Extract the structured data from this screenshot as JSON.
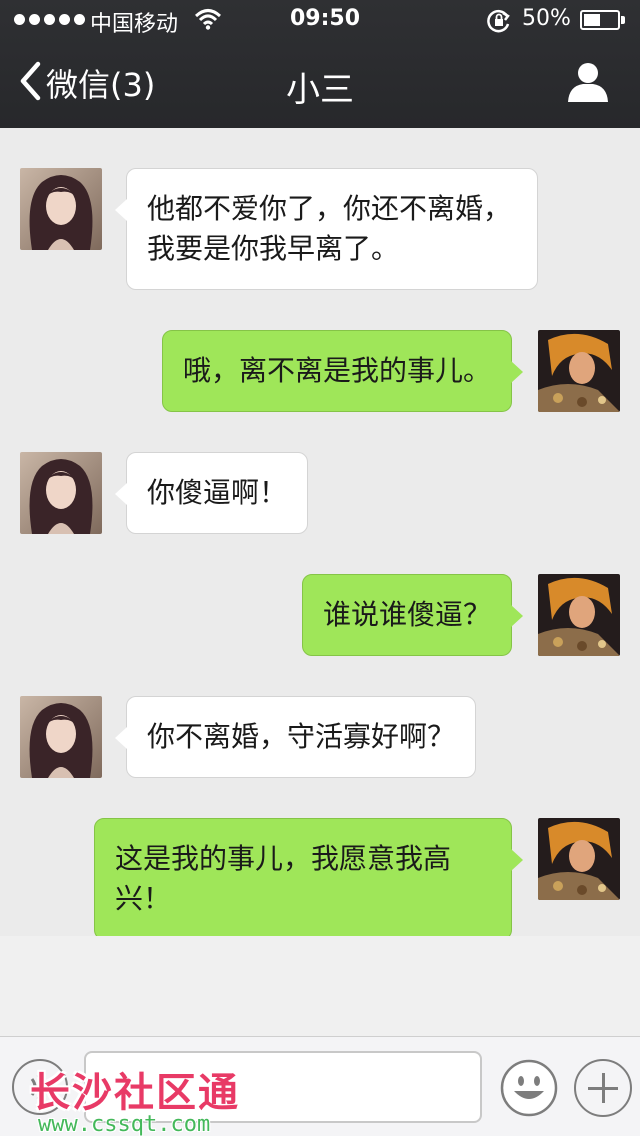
{
  "status_bar": {
    "carrier": "中国移动",
    "time": "09:50",
    "battery_percent": "50%",
    "battery_level": 0.5,
    "signal_dots": 5,
    "icons": [
      "wifi-icon",
      "rotation-lock-icon",
      "battery-icon"
    ]
  },
  "nav": {
    "back_label": "微信(3)",
    "title": "小三",
    "back_icon": "chevron-left-icon",
    "profile_icon": "person-icon"
  },
  "messages": [
    {
      "side": "left",
      "text": "他都不爱你了，你还不离婚，我要是你我早离了。"
    },
    {
      "side": "right",
      "text": "哦，离不离是我的事儿。"
    },
    {
      "side": "left",
      "text": "你傻逼啊！"
    },
    {
      "side": "right",
      "text": "谁说谁傻逼？"
    },
    {
      "side": "left",
      "text": "你不离婚，守活寡好啊？"
    },
    {
      "side": "right",
      "text": "这是我的事儿，我愿意我高兴！"
    }
  ],
  "input_bar": {
    "value": "",
    "icons": [
      "voice-icon",
      "emoji-icon",
      "plus-icon"
    ]
  },
  "watermark": {
    "title": "长沙社区通",
    "url": "www.cssqt.com"
  },
  "colors": {
    "header_bg": "#2f3033",
    "chat_bg": "#ebebeb",
    "bubble_incoming": "#ffffff",
    "bubble_outgoing": "#9fe659",
    "watermark_title": "#e83a66",
    "watermark_url": "#44b85a"
  }
}
